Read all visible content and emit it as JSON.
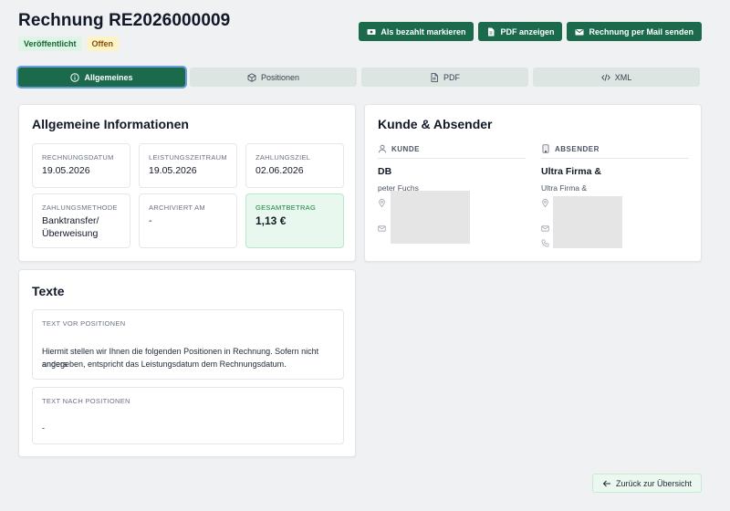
{
  "header": {
    "title": "Rechnung RE2026000009",
    "badges": {
      "published": "Veröffentlicht",
      "open": "Offen"
    },
    "actions": {
      "mark_paid": "Als bezahlt markieren",
      "show_pdf": "PDF anzeigen",
      "send_mail": "Rechnung per Mail senden"
    }
  },
  "tabs": [
    {
      "label": "Allgemeines",
      "icon": "info-icon",
      "active": true
    },
    {
      "label": "Positionen",
      "icon": "box-icon",
      "active": false
    },
    {
      "label": "PDF",
      "icon": "file-icon",
      "active": false
    },
    {
      "label": "XML",
      "icon": "code-icon",
      "active": false
    }
  ],
  "general": {
    "title": "Allgemeine Informationen",
    "fields": {
      "invoice_date": {
        "label": "Rechnungsdatum",
        "value": "19.05.2026"
      },
      "service_period": {
        "label": "Leistungszeitraum",
        "value": "19.05.2026"
      },
      "due_date": {
        "label": "Zahlungsziel",
        "value": "02.06.2026"
      },
      "payment_method": {
        "label": "Zahlungsmethode",
        "value_line1": "Banktransfer/",
        "value_line2": "Überweisung"
      },
      "archived_at": {
        "label": "Archiviert am",
        "value": "-"
      },
      "total": {
        "label": "Gesamtbetrag",
        "value": "1,13 €"
      }
    }
  },
  "parties": {
    "title": "Kunde & Absender",
    "customer": {
      "heading": "KUNDE",
      "name": "DB",
      "contact": "peter Fuchs"
    },
    "sender": {
      "heading": "ABSENDER",
      "name": "Ultra Firma &",
      "contact": "Ultra Firma &"
    }
  },
  "texts": {
    "title": "Texte",
    "before": {
      "label": "TEXT VOR POSITIONEN",
      "line1": "Hiermit stellen wir Ihnen die folgenden Positionen in Rechnung. Sofern nicht anders",
      "line2": "angegeben, entspricht das Leistungsdatum dem Rechnungsdatum."
    },
    "after": {
      "label": "TEXT NACH POSITIONEN",
      "value": "-"
    }
  },
  "footer": {
    "back": "Zurück zur Übersicht"
  },
  "colors": {
    "primary": "#1a6a4b",
    "tab_inactive": "#dde5e2",
    "total_bg": "#e8f8ee",
    "badge_green_bg": "#dcf5e4",
    "badge_yellow_bg": "#fdf3c4"
  }
}
